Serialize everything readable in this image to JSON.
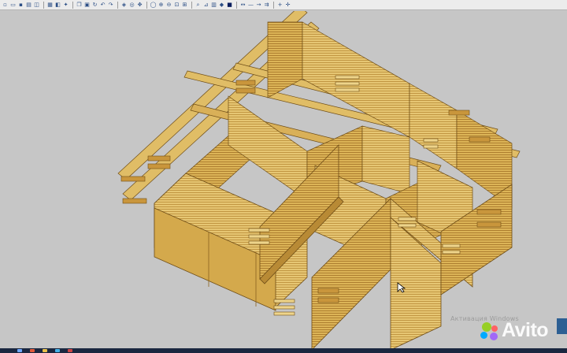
{
  "toolbar": {
    "icons": [
      "new-file-icon",
      "open-icon",
      "save-icon",
      "print-icon",
      "preview-icon",
      "separator",
      "table-icon",
      "layer-icon",
      "settings-icon",
      "separator",
      "copy-icon",
      "paste-icon",
      "rotate-icon",
      "undo-icon",
      "redo-icon",
      "separator",
      "view-cube-icon",
      "orbit-icon",
      "pan-icon",
      "separator",
      "zoom-icon",
      "zoom-in-icon",
      "zoom-out-icon",
      "zoom-window-icon",
      "zoom-extents-icon",
      "separator",
      "find-icon",
      "measure-icon",
      "grid-icon",
      "snap-icon",
      "color-swatch-icon",
      "separator",
      "dimension-icon",
      "line-tool-icon",
      "arrow-tool-icon",
      "offset-icon",
      "separator",
      "plus-icon",
      "move-icon"
    ]
  },
  "watermark": {
    "text": "Активация Windows"
  },
  "brand": {
    "logo_text": "Avito"
  },
  "colors": {
    "background": "#c6c6c6",
    "log_light": "#e3c470",
    "log_mid": "#d8ad4d",
    "log_dark": "#a8782a",
    "outline": "#6e4d17"
  }
}
